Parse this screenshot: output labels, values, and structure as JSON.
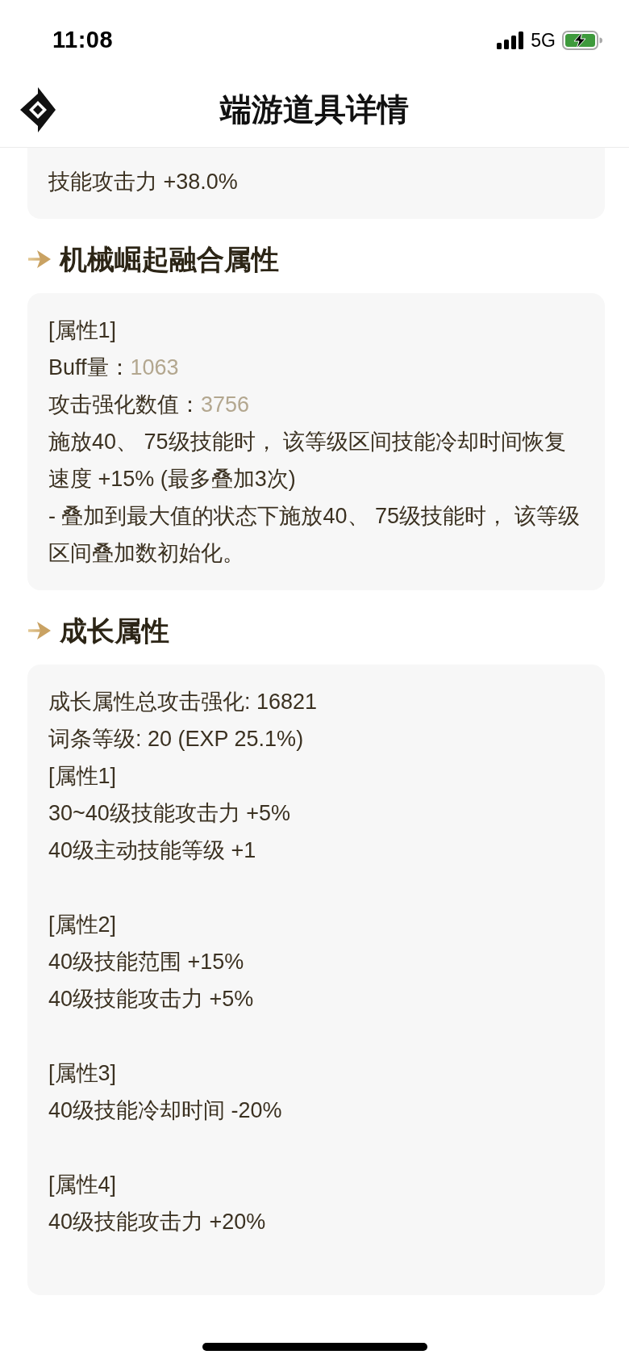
{
  "status_bar": {
    "time": "11:08",
    "network": "5G"
  },
  "header": {
    "title": "端游道具详情"
  },
  "sections": [
    {
      "groups": [
        {
          "lines": [
            {
              "kind": "text",
              "text": "技能攻击力 +38.0%"
            }
          ]
        }
      ]
    },
    {
      "heading": "机械崛起融合属性",
      "groups": [
        {
          "lines": [
            {
              "kind": "text",
              "text": "[属性1]"
            },
            {
              "kind": "stat",
              "label": "Buff量：",
              "value": "1063"
            },
            {
              "kind": "stat",
              "label": "攻击强化数值：",
              "value": "3756"
            },
            {
              "kind": "text",
              "text": "施放40、 75级技能时， 该等级区间技能冷却时间恢复速度 +15% (最多叠加3次)"
            },
            {
              "kind": "text",
              "text": "- 叠加到最大值的状态下施放40、 75级技能时， 该等级区间叠加数初始化。"
            }
          ]
        }
      ]
    },
    {
      "heading": "成长属性",
      "groups": [
        {
          "lines": [
            {
              "kind": "text",
              "text": "成长属性总攻击强化: 16821"
            },
            {
              "kind": "text",
              "text": "词条等级: 20 (EXP 25.1%)"
            },
            {
              "kind": "text",
              "text": "[属性1]"
            },
            {
              "kind": "text",
              "text": "30~40级技能攻击力 +5%"
            },
            {
              "kind": "text",
              "text": "40级主动技能等级 +1"
            }
          ]
        },
        {
          "lines": [
            {
              "kind": "text",
              "text": "[属性2]"
            },
            {
              "kind": "text",
              "text": "40级技能范围 +15%"
            },
            {
              "kind": "text",
              "text": "40级技能攻击力 +5%"
            }
          ]
        },
        {
          "lines": [
            {
              "kind": "text",
              "text": "[属性3]"
            },
            {
              "kind": "text",
              "text": "40级技能冷却时间 -20%"
            }
          ]
        },
        {
          "lines": [
            {
              "kind": "text",
              "text": "[属性4]"
            },
            {
              "kind": "text",
              "text": "40级技能攻击力 +20%"
            }
          ]
        }
      ]
    }
  ]
}
